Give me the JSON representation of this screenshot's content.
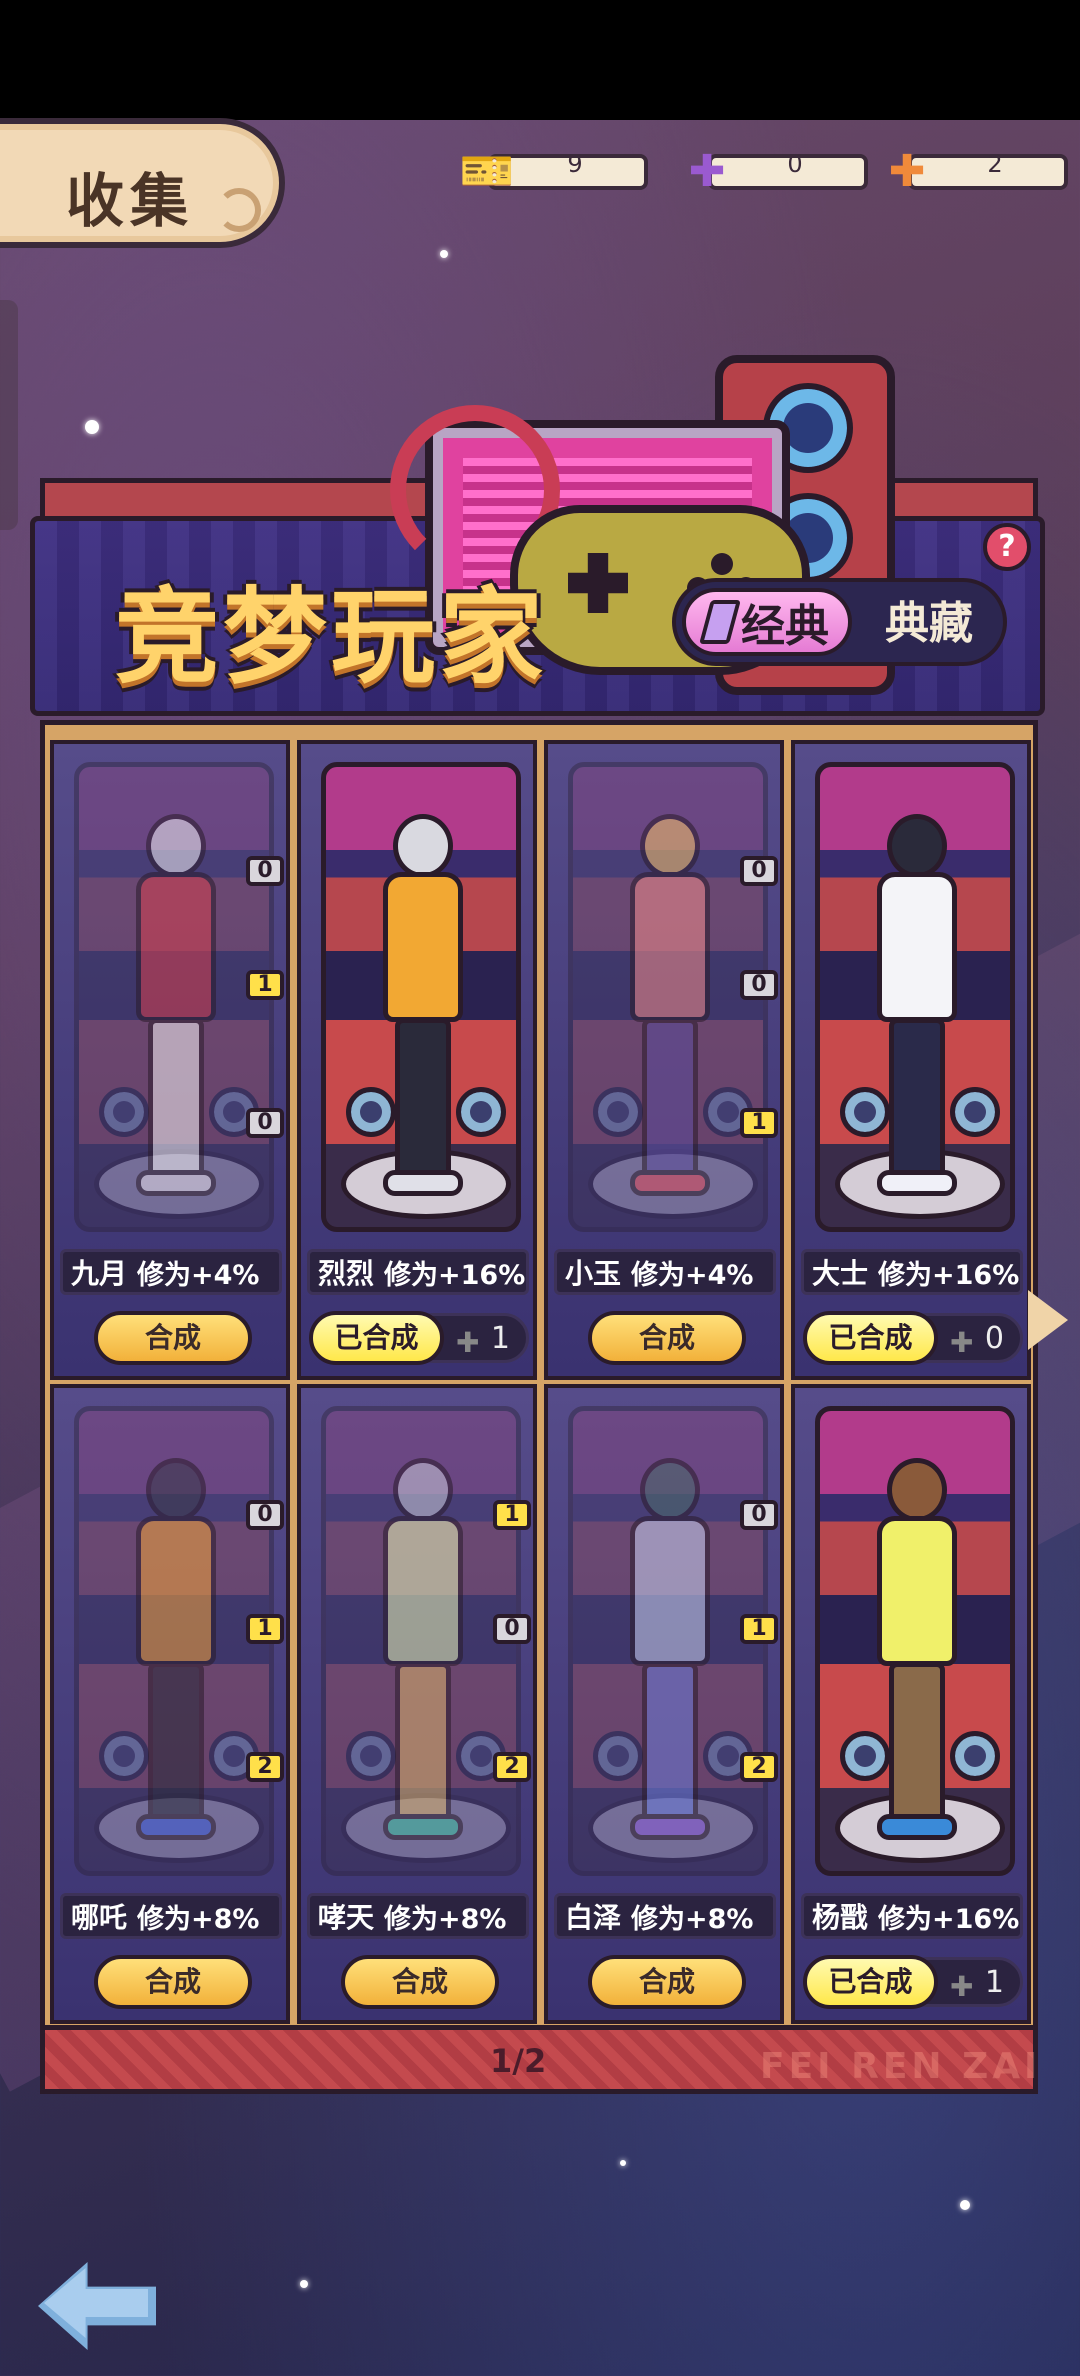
{
  "header": {
    "title": "收集"
  },
  "currencies": [
    {
      "icon": "ticket-icon",
      "value": "9"
    },
    {
      "icon": "purple-puzzle-icon",
      "value": "0"
    },
    {
      "icon": "orange-puzzle-icon",
      "value": "2"
    }
  ],
  "banner": {
    "title": "竞梦玩家",
    "tab_active": "经典",
    "tab_inactive": "典藏",
    "help": "?"
  },
  "cards": [
    {
      "name": "九月",
      "bonus": "修为+4%",
      "status": "craft",
      "action": "合成",
      "badges": [
        "0",
        "1",
        "0"
      ],
      "owned": false
    },
    {
      "name": "烈烈",
      "bonus": "修为+16%",
      "status": "done",
      "action": "已合成",
      "pieces": "1",
      "badges": [],
      "owned": true
    },
    {
      "name": "小玉",
      "bonus": "修为+4%",
      "status": "craft",
      "action": "合成",
      "badges": [
        "0",
        "0",
        "1"
      ],
      "owned": false
    },
    {
      "name": "大士",
      "bonus": "修为+16%",
      "status": "done",
      "action": "已合成",
      "pieces": "0",
      "badges": [],
      "owned": true
    },
    {
      "name": "哪吒",
      "bonus": "修为+8%",
      "status": "craft",
      "action": "合成",
      "badges": [
        "0",
        "1",
        "2"
      ],
      "owned": false
    },
    {
      "name": "哮天",
      "bonus": "修为+8%",
      "status": "craft",
      "action": "合成",
      "badges": [
        "1",
        "0",
        "2"
      ],
      "owned": false
    },
    {
      "name": "白泽",
      "bonus": "修为+8%",
      "status": "craft",
      "action": "合成",
      "badges": [
        "0",
        "1",
        "2"
      ],
      "owned": false
    },
    {
      "name": "杨戬",
      "bonus": "修为+16%",
      "status": "done",
      "action": "已合成",
      "pieces": "1",
      "badges": [],
      "owned": true
    }
  ],
  "pagination": {
    "label": "1/2"
  },
  "brand": "FEI REN ZAI",
  "colors": {
    "accent_gold": "#ffe04a",
    "panel_red": "#b6474e",
    "card_purple": "#564c8a"
  }
}
